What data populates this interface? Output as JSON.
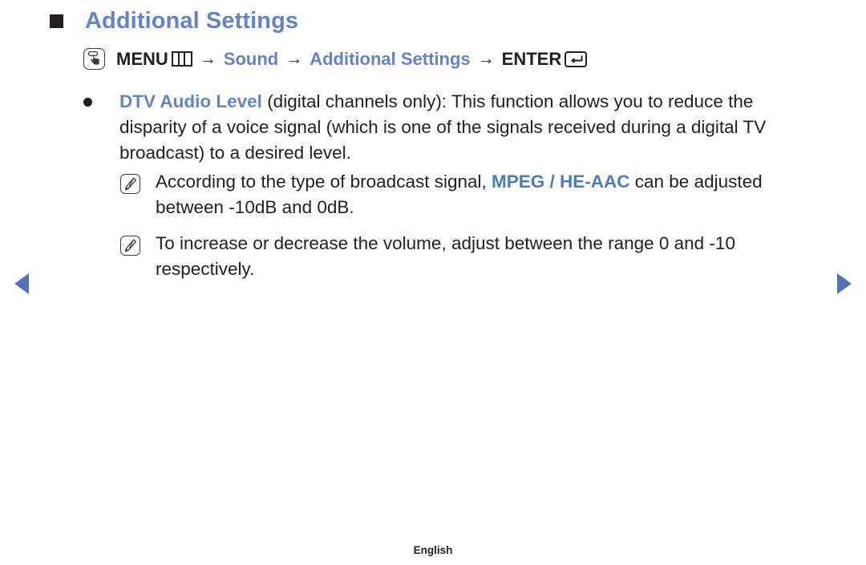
{
  "heading": {
    "marker_icon": "square-bullet-icon",
    "title": "Additional Settings"
  },
  "menu_path": {
    "hand_icon": "oo-hand-press-icon",
    "menu_label": "MENU",
    "menu_icon": "menu-grid-icon",
    "arrow1": "→",
    "sound_label": "Sound",
    "arrow2": "→",
    "additional_settings_label": "Additional Settings",
    "arrow3": "→",
    "enter_label": "ENTER",
    "enter_icon": "enter-key-icon"
  },
  "content": {
    "bullet": {
      "bullet_icon": "round-bullet-icon",
      "term": "DTV Audio Level",
      "body": " (digital channels only): This function allows you to reduce the disparity of a voice signal (which is one of the signals received during a digital TV broadcast) to a desired level."
    },
    "notes": [
      {
        "note_icon": "note-pen-icon",
        "text_before": "According to the type of broadcast signal, ",
        "highlight": "MPEG / HE-AAC",
        "text_after": " can be adjusted between -10dB and 0dB."
      },
      {
        "note_icon": "note-pen-icon",
        "text_before": "To increase or decrease the volume, adjust between the range 0 and -10 respectively.",
        "highlight": "",
        "text_after": ""
      }
    ]
  },
  "navigation": {
    "prev_icon": "triangle-left-icon",
    "next_icon": "triangle-right-icon"
  },
  "footer": {
    "language": "English"
  },
  "colors": {
    "accent_blue": "#6383c8",
    "highlight_blue": "#4a7ac4",
    "nav_blue": "#5273b8",
    "text_black": "#231f20",
    "background": "#ffffff"
  }
}
